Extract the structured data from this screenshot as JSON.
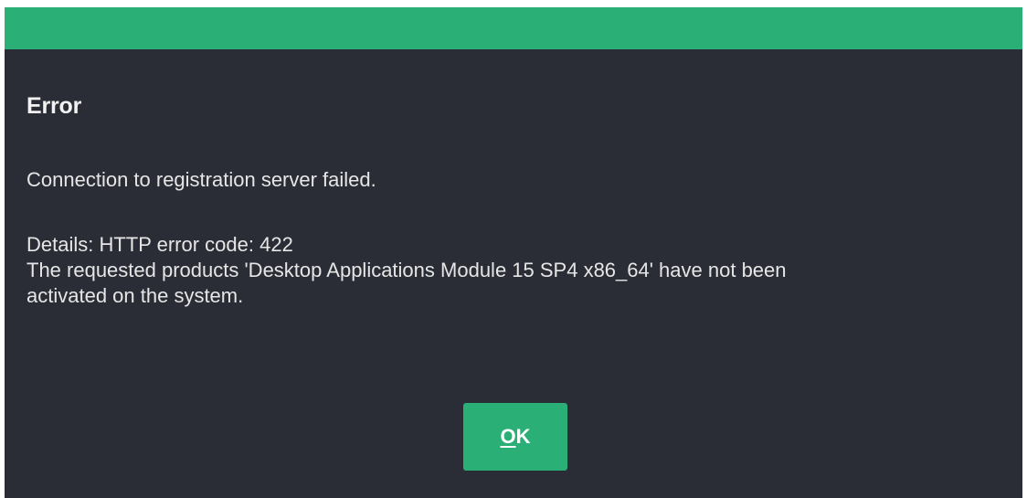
{
  "dialog": {
    "title": "Error",
    "message": "Connection to registration server failed.",
    "details": [
      "Details: HTTP error code: 422",
      "The requested products 'Desktop Applications Module 15 SP4 x86_64' have not been",
      "activated on the system."
    ],
    "ok_button": {
      "mnemonic": "O",
      "rest": "K"
    }
  },
  "colors": {
    "accent": "#2ab077",
    "background": "#2b2d36",
    "text": "#e6e6e6"
  }
}
